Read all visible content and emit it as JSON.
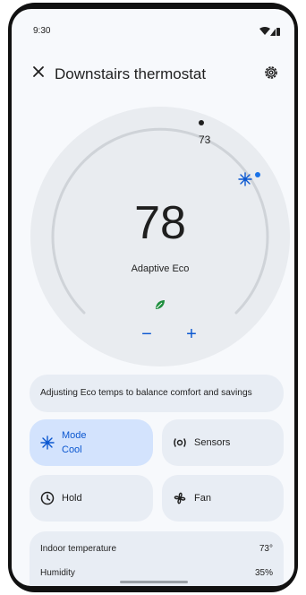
{
  "status_bar": {
    "time": "9:30",
    "icons": [
      "wifi-icon",
      "signal-icon",
      "battery-icon"
    ]
  },
  "header": {
    "close_icon": "close-icon",
    "title": "Downstairs thermostat",
    "settings_icon": "gear-icon"
  },
  "dial": {
    "current_temp": "78",
    "setpoint": "73",
    "mode_label": "Adaptive Eco",
    "minus_label": "−",
    "plus_label": "+",
    "accent_color": "#0b57d0"
  },
  "banner": {
    "text": "Adjusting Eco temps to balance comfort and savings"
  },
  "tiles": {
    "mode": {
      "label": "Mode",
      "value": "Cool",
      "icon": "snowflake-icon"
    },
    "sensors": {
      "label": "Sensors",
      "icon": "sensor-icon"
    },
    "hold": {
      "label": "Hold",
      "icon": "clock-icon"
    },
    "fan": {
      "label": "Fan",
      "icon": "fan-icon"
    }
  },
  "info": {
    "indoor_label": "Indoor temperature",
    "indoor_value": "73°",
    "humidity_label": "Humidity",
    "humidity_value": "35%"
  }
}
